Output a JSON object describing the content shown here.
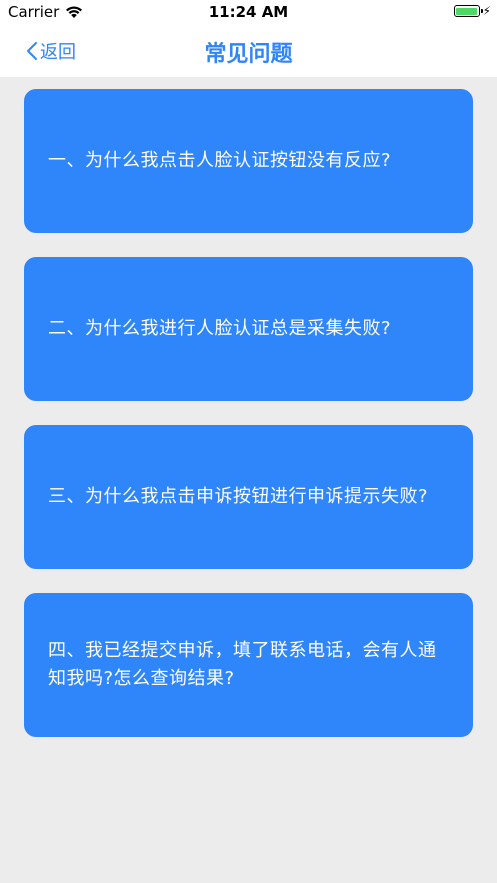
{
  "status_bar": {
    "carrier": "Carrier",
    "time": "11:24 AM",
    "battery_level": 1.0
  },
  "nav": {
    "back_label": "返回",
    "title": "常见问题"
  },
  "faq": {
    "items": [
      {
        "question": "一、为什么我点击人脸认证按钮没有反应?"
      },
      {
        "question": "二、为什么我进行人脸认证总是采集失败?"
      },
      {
        "question": "三、为什么我点击申诉按钮进行申诉提示失败?"
      },
      {
        "question": "四、我已经提交申诉，填了联系电话，会有人通知我吗?怎么查询结果?"
      }
    ]
  },
  "colors": {
    "accent": "#2e86fa",
    "background": "#ececec",
    "card_text": "#ffffff"
  }
}
